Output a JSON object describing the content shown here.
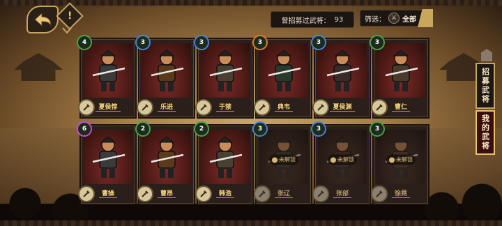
{
  "header": {
    "recruit_label": "曾招募过武将：",
    "recruit_count": "93",
    "filter_label": "筛选：",
    "filter_value": "全部"
  },
  "tabs": {
    "recruited": "招募武将",
    "mine": "我的武将"
  },
  "cards": [
    {
      "rank": "4",
      "rank_color": "#4aa14a",
      "name": "夏侯惇",
      "locked": false
    },
    {
      "rank": "3",
      "rank_color": "#4a82d2",
      "name": "乐进",
      "locked": false
    },
    {
      "rank": "3",
      "rank_color": "#4a82d2",
      "name": "于禁",
      "locked": false
    },
    {
      "rank": "3",
      "rank_color": "#e07a2a",
      "name": "典韦",
      "locked": false
    },
    {
      "rank": "3",
      "rank_color": "#4a82d2",
      "name": "夏侯渊",
      "locked": false
    },
    {
      "rank": "3",
      "rank_color": "#4aa14a",
      "name": "曹仁",
      "locked": false
    },
    {
      "rank": "6",
      "rank_color": "#c84ad2",
      "name": "曹操",
      "locked": false
    },
    {
      "rank": "2",
      "rank_color": "#4aa14a",
      "name": "曹昂",
      "locked": false
    },
    {
      "rank": "2",
      "rank_color": "#4aa14a",
      "name": "韩浩",
      "locked": false
    },
    {
      "rank": "3",
      "rank_color": "#4a82d2",
      "name": "张辽",
      "locked": true,
      "locked_text": "未解锁"
    },
    {
      "rank": "3",
      "rank_color": "#4a82d2",
      "name": "张郃",
      "locked": true,
      "locked_text": "未解锁"
    },
    {
      "rank": "3",
      "rank_color": "#4aa14a",
      "name": "徐晃",
      "locked": true,
      "locked_text": "未解锁"
    }
  ]
}
